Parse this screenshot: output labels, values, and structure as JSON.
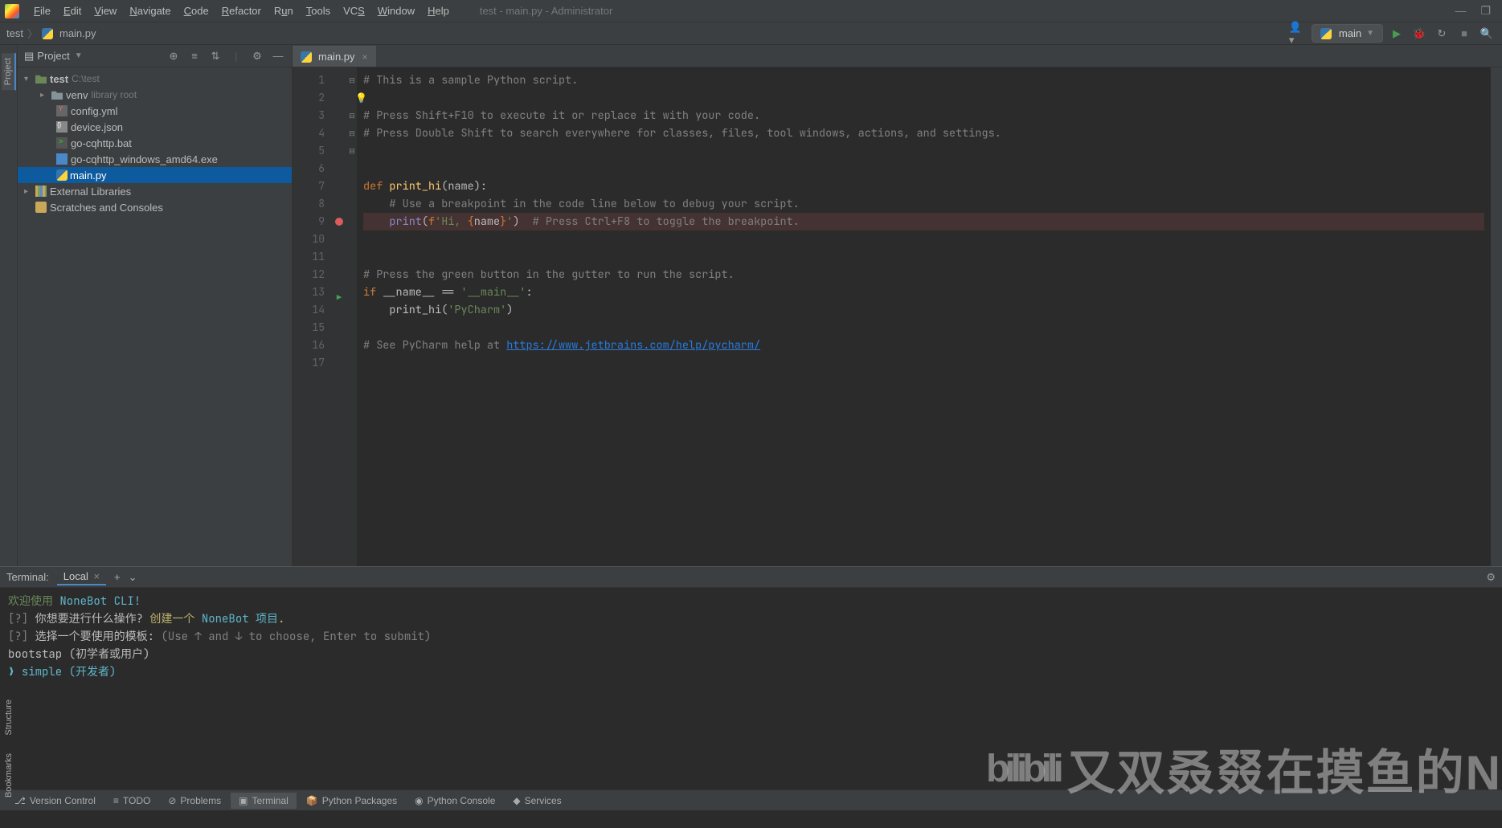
{
  "window": {
    "title": "test - main.py - Administrator"
  },
  "menu": [
    "File",
    "Edit",
    "View",
    "Navigate",
    "Code",
    "Refactor",
    "Run",
    "Tools",
    "VCS",
    "Window",
    "Help"
  ],
  "breadcrumb": {
    "root": "test",
    "file": "main.py"
  },
  "run_config": {
    "name": "main"
  },
  "sidebar": {
    "title": "Project",
    "tree": {
      "root": {
        "name": "test",
        "path": "C:\\test"
      },
      "venv": {
        "name": "venv",
        "hint": "library root"
      },
      "files": [
        {
          "name": "config.yml",
          "ico": "yml"
        },
        {
          "name": "device.json",
          "ico": "json"
        },
        {
          "name": "go-cqhttp.bat",
          "ico": "bat"
        },
        {
          "name": "go-cqhttp_windows_amd64.exe",
          "ico": "exe"
        },
        {
          "name": "main.py",
          "ico": "py",
          "selected": true
        }
      ],
      "ext_lib": "External Libraries",
      "scratch": "Scratches and Consoles"
    }
  },
  "editor": {
    "tab": "main.py",
    "lines": [
      "1",
      "2",
      "3",
      "4",
      "5",
      "6",
      "7",
      "8",
      "9",
      "10",
      "11",
      "12",
      "13",
      "14",
      "15",
      "16",
      "17"
    ],
    "code": {
      "l1": "# This is a sample Python script.",
      "l3": "# Press Shift+F10 to execute it or replace it with your code.",
      "l4": "# Press Double Shift to search everywhere for classes, files, tool windows, actions, and settings.",
      "l7_def": "def ",
      "l7_name": "print_hi",
      "l7_rest": "(name):",
      "l8": "    # Use a breakpoint in the code line below to debug your script.",
      "l9_print": "print",
      "l9_open": "(",
      "l9_f": "f",
      "l9_s1": "'Hi, ",
      "l9_br1": "{",
      "l9_var": "name",
      "l9_br2": "}",
      "l9_s2": "'",
      "l9_close": ")",
      "l9_c": "  # Press Ctrl+F8 to toggle the breakpoint.",
      "l12": "# Press the green button in the gutter to run the script.",
      "l13_if": "if ",
      "l13_name": "__name__",
      "l13_eq": " == ",
      "l13_main": "'__main__'",
      "l13_colon": ":",
      "l14_call": "    print_hi(",
      "l14_arg": "'PyCharm'",
      "l14_close": ")",
      "l16_a": "# See PyCharm help at ",
      "l16_link": "https://www.jetbrains.com/help/pycharm/"
    }
  },
  "terminal": {
    "title": "Terminal:",
    "tab": "Local",
    "lines": {
      "welcome_a": "欢迎使用 ",
      "welcome_b": "NoneBot CLI!",
      "q1_prefix": "[?] ",
      "q1": "你想要进行什么操作? ",
      "q1_ans": "创建一个 ",
      "q1_ans2": "NoneBot 项目",
      "q1_dot": ".",
      "q2_prefix": "[?] ",
      "q2": "选择一个要使用的模板: ",
      "q2_hint": "(Use ↑ and ↓ to choose, Enter to submit)",
      "opt1": "  bootstap (初学者或用户)",
      "opt2_arrow": "❯ ",
      "opt2": "simple (开发者)"
    }
  },
  "bottom_tools": [
    "Version Control",
    "TODO",
    "Problems",
    "Terminal",
    "Python Packages",
    "Python Console",
    "Services"
  ],
  "left_tabs": {
    "project": "Project",
    "structure": "Structure",
    "bookmarks": "Bookmarks"
  },
  "watermark": "又双叒叕在摸鱼的N"
}
